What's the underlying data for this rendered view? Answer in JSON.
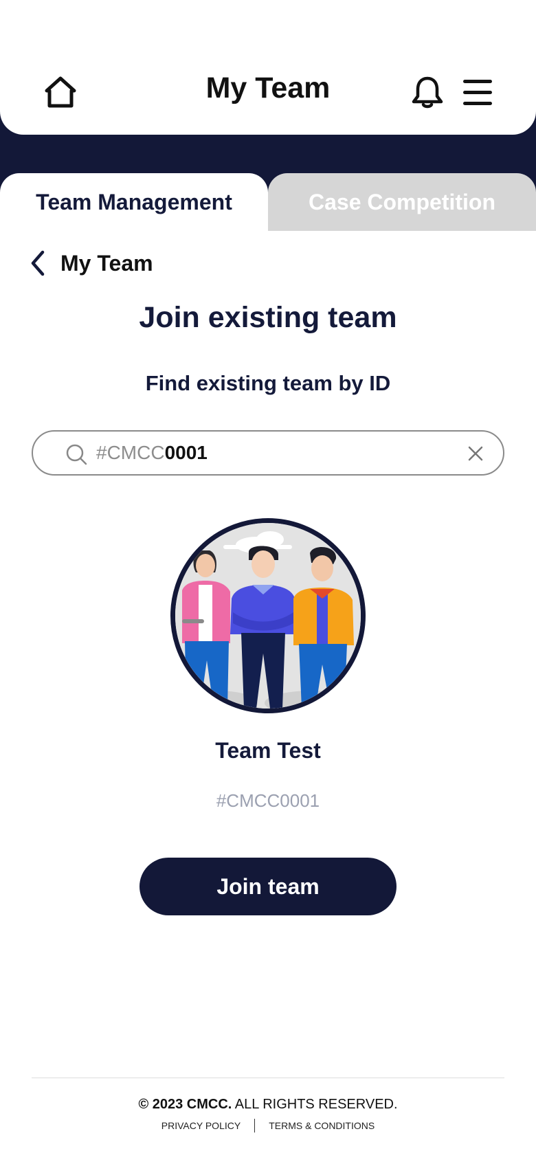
{
  "header": {
    "title": "My Team",
    "icons": {
      "home": "home-icon",
      "bell": "bell-icon",
      "menu": "menu-icon"
    }
  },
  "tabs": [
    {
      "label": "Team Management",
      "active": true
    },
    {
      "label": "Case Competition",
      "active": false
    }
  ],
  "breadcrumb": {
    "back_label": "My Team"
  },
  "main": {
    "title": "Join existing team",
    "subtitle": "Find existing team by ID"
  },
  "search": {
    "prefix": "#CMCC",
    "value": "0001"
  },
  "team": {
    "name": "Team Test",
    "id": "#CMCC0001"
  },
  "actions": {
    "join_label": "Join team"
  },
  "footer": {
    "copyright_symbol_year_brand": "© 2023 CMCC.",
    "copyright_rest": " ALL RIGHTS RESERVED.",
    "privacy": "PRIVACY POLICY",
    "terms": "TERMS & CONDITIONS"
  },
  "colors": {
    "navy": "#131838",
    "tab_inactive": "#d6d6d6",
    "muted_text": "#9ba0b0"
  }
}
